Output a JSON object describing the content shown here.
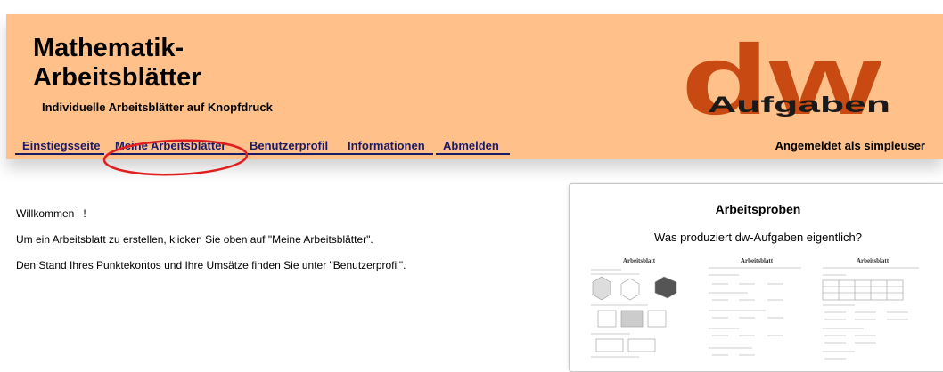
{
  "header": {
    "title_line1": "Mathematik-",
    "title_line2": "Arbeitsblätter",
    "subtitle": "Individuelle Arbeitsblätter auf Knopfdruck",
    "logo_big": "dw",
    "logo_small": "Aufgaben",
    "logo_color": "#c84a12",
    "background_color": "#ffc08a"
  },
  "nav": {
    "items": [
      {
        "label": "Einstiegsseite"
      },
      {
        "label": "Meine Arbeitsblätter"
      },
      {
        "label": "Benutzerprofil"
      },
      {
        "label": "Informationen"
      },
      {
        "label": "Abmelden"
      }
    ],
    "link_color": "#1a1a66",
    "login_status": "Angemeldet als simpleuser"
  },
  "welcome": {
    "greeting": "Willkommen   !",
    "line1": "Um ein Arbeitsblatt zu erstellen, klicken Sie oben auf \"Meine Arbeitsblätter\".",
    "line2": "Den Stand Ihres Punktekontos und Ihre Umsätze finden Sie unter \"Benutzerprofil\"."
  },
  "samples": {
    "title": "Arbeitsproben",
    "subtitle": "Was produziert dw-Aufgaben eigentlich?",
    "thumbnails": [
      {
        "title": "Arbeitsblatt"
      },
      {
        "title": "Arbeitsblatt"
      },
      {
        "title": "Arbeitsblatt"
      }
    ]
  },
  "annotation_color": "#e02020"
}
